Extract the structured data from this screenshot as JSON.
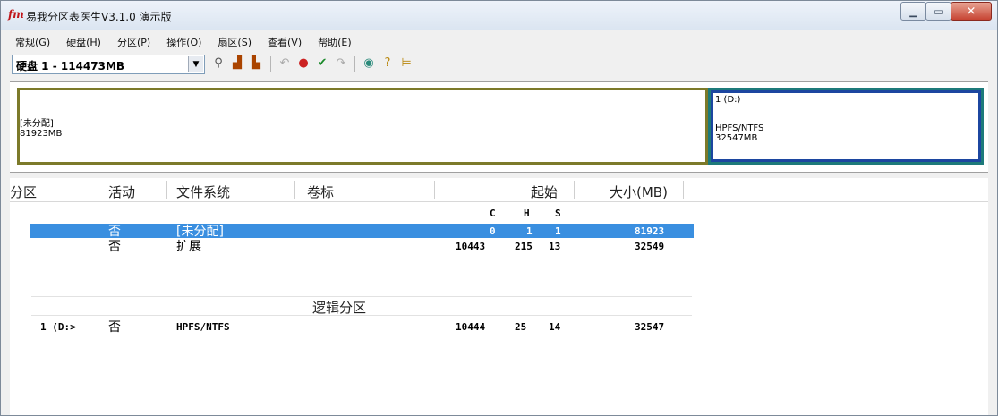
{
  "window": {
    "title": "易我分区表医生V3.1.0 演示版",
    "app_icon": "fm"
  },
  "menu": [
    {
      "label": "常规(G)"
    },
    {
      "label": "硬盘(H)"
    },
    {
      "label": "分区(P)"
    },
    {
      "label": "操作(O)"
    },
    {
      "label": "扇区(S)"
    },
    {
      "label": "查看(V)"
    },
    {
      "label": "帮助(E)"
    }
  ],
  "toolbar": {
    "disk_selected": "硬盘 1 - 114473MB"
  },
  "diskmap": {
    "unallocated": {
      "label": "[未分配]",
      "size": "81923MB"
    },
    "partition": {
      "label": "1 (D:)",
      "fs": "HPFS/NTFS",
      "size": "32547MB"
    }
  },
  "table": {
    "headers": {
      "partition": "分区",
      "active": "活动",
      "filesystem": "文件系统",
      "volume": "卷标",
      "start": "起始",
      "size": "大小(MB)"
    },
    "chs": {
      "c": "C",
      "h": "H",
      "s": "S"
    },
    "rows": [
      {
        "partition": "",
        "active": "否",
        "filesystem": "[未分配]",
        "c": "0",
        "h": "1",
        "s": "1",
        "size": "81923"
      },
      {
        "partition": "",
        "active": "否",
        "filesystem": "扩展",
        "c": "10443",
        "h": "215",
        "s": "13",
        "size": "32549"
      }
    ],
    "logical_header": "逻辑分区",
    "logical_rows": [
      {
        "partition": "1 (D:>",
        "active": "否",
        "filesystem": "HPFS/NTFS",
        "c": "10444",
        "h": "25",
        "s": "14",
        "size": "32547"
      }
    ]
  }
}
